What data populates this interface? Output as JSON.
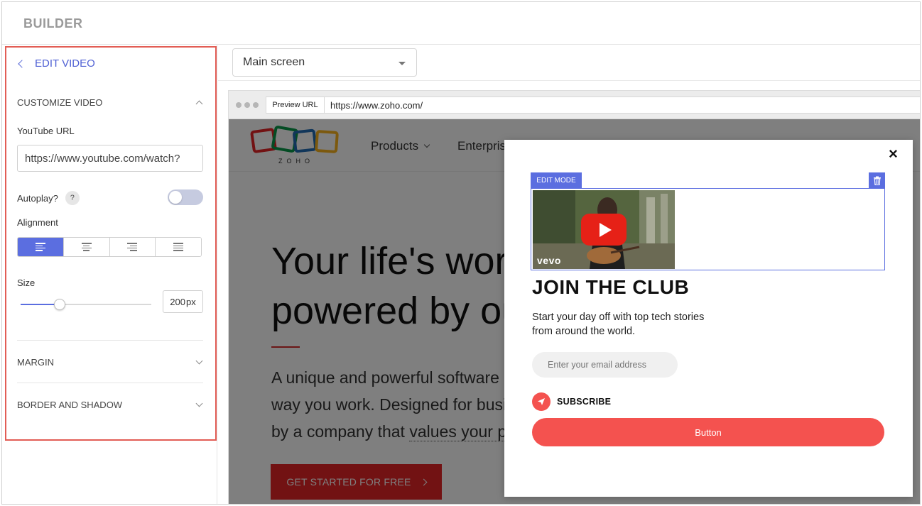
{
  "app": {
    "brand": "BUILDER"
  },
  "sidebar": {
    "back_label": "EDIT VIDEO",
    "customize_section": "CUSTOMIZE VIDEO",
    "youtube_url_label": "YouTube URL",
    "youtube_url_value": "https://www.youtube.com/watch?",
    "autoplay_label": "Autoplay?",
    "help_glyph": "?",
    "autoplay_on": false,
    "alignment_label": "Alignment",
    "alignment_options": [
      "left",
      "center",
      "right",
      "justify"
    ],
    "alignment_selected": "left",
    "size_label": "Size",
    "size_value": "200",
    "size_unit": "px",
    "size_slider_fraction": 0.3,
    "margin_section": "MARGIN",
    "border_section": "BORDER AND SHADOW"
  },
  "main": {
    "screen_select_value": "Main screen"
  },
  "browser": {
    "preview_label": "Preview URL",
    "url": "https://www.zoho.com/"
  },
  "site": {
    "logo_text": "ZOHO",
    "nav": [
      "Products",
      "Enterprise"
    ],
    "hero_line1": "Your life's work,",
    "hero_line2": "powered by our life's work",
    "hero_p1": "A unique and powerful software suite to transform the",
    "hero_p2": "way you work. Designed for businesses of all sizes, built",
    "hero_p3_prefix": "by a company that ",
    "hero_p3_link": "values your privacy.",
    "cta_label": "GET STARTED FOR FREE"
  },
  "modal": {
    "close_glyph": "×",
    "edit_mode_label": "EDIT MODE",
    "video_watermark": "vevo",
    "title": "JOIN THE CLUB",
    "subtitle": "Start your day off with top tech stories from around the world.",
    "email_placeholder": "Enter your email address",
    "subscribe_label": "SUBSCRIBE",
    "button_label": "Button"
  },
  "colors": {
    "accent": "#5b6ee0",
    "highlight_border": "#e25d55",
    "cta_red": "#e42527",
    "popup_red": "#f4524f"
  },
  "icons": [
    "chevron-left-icon",
    "chevron-up-icon",
    "chevron-down-icon",
    "help-icon",
    "align-left-icon",
    "align-center-icon",
    "align-right-icon",
    "align-justify-icon",
    "trash-icon",
    "close-icon",
    "play-icon",
    "send-icon"
  ]
}
